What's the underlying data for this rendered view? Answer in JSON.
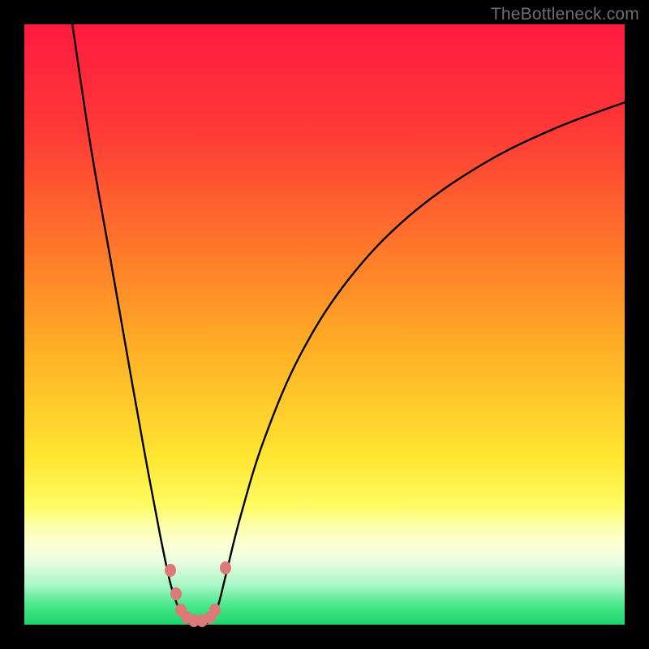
{
  "watermark": "TheBottleneck.com",
  "chart_data": {
    "type": "line",
    "title": "",
    "xlabel": "",
    "ylabel": "",
    "xlim": [
      0,
      100
    ],
    "ylim": [
      0,
      100
    ],
    "grid": false,
    "legend": false,
    "background_gradient": {
      "stops": [
        {
          "pos": 0.0,
          "color": "#ff1a3f"
        },
        {
          "pos": 0.18,
          "color": "#ff3a36"
        },
        {
          "pos": 0.38,
          "color": "#ff7a2a"
        },
        {
          "pos": 0.56,
          "color": "#ffb526"
        },
        {
          "pos": 0.72,
          "color": "#ffe531"
        },
        {
          "pos": 0.8,
          "color": "#fffb60"
        },
        {
          "pos": 0.835,
          "color": "#fdffa8"
        },
        {
          "pos": 0.868,
          "color": "#fbffd6"
        },
        {
          "pos": 0.895,
          "color": "#eafce0"
        },
        {
          "pos": 0.935,
          "color": "#a6f7c3"
        },
        {
          "pos": 0.965,
          "color": "#4fe88f"
        },
        {
          "pos": 1.0,
          "color": "#18d66b"
        }
      ]
    },
    "series": [
      {
        "name": "bottleneck-curve",
        "stroke": "#000000",
        "stroke_width": 2.4,
        "points": [
          {
            "x": 8.0,
            "y": 100.0
          },
          {
            "x": 11.0,
            "y": 80.0
          },
          {
            "x": 14.5,
            "y": 60.0
          },
          {
            "x": 18.0,
            "y": 40.0
          },
          {
            "x": 20.7,
            "y": 25.0
          },
          {
            "x": 22.8,
            "y": 14.0
          },
          {
            "x": 24.3,
            "y": 7.0
          },
          {
            "x": 25.6,
            "y": 3.0
          },
          {
            "x": 27.0,
            "y": 0.5
          },
          {
            "x": 29.0,
            "y": 0.3
          },
          {
            "x": 30.8,
            "y": 0.5
          },
          {
            "x": 32.2,
            "y": 3.0
          },
          {
            "x": 33.5,
            "y": 8.0
          },
          {
            "x": 36.0,
            "y": 18.0
          },
          {
            "x": 40.0,
            "y": 31.0
          },
          {
            "x": 46.0,
            "y": 45.0
          },
          {
            "x": 54.0,
            "y": 57.5
          },
          {
            "x": 64.0,
            "y": 68.0
          },
          {
            "x": 76.0,
            "y": 76.5
          },
          {
            "x": 88.0,
            "y": 82.5
          },
          {
            "x": 100.0,
            "y": 87.0
          }
        ]
      }
    ],
    "markers": [
      {
        "x": 24.3,
        "y": 9.0
      },
      {
        "x": 25.3,
        "y": 5.2
      },
      {
        "x": 26.1,
        "y": 2.5
      },
      {
        "x": 27.0,
        "y": 1.2
      },
      {
        "x": 28.3,
        "y": 0.7
      },
      {
        "x": 29.6,
        "y": 0.7
      },
      {
        "x": 30.9,
        "y": 1.2
      },
      {
        "x": 31.8,
        "y": 2.5
      },
      {
        "x": 33.5,
        "y": 9.5
      }
    ],
    "marker_color": "#db7a78"
  }
}
